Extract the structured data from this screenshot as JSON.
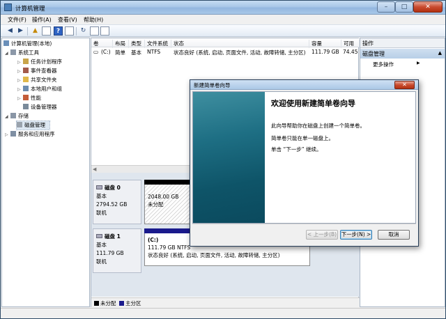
{
  "window": {
    "title": "计算机管理"
  },
  "menu": [
    "文件(F)",
    "操作(A)",
    "查看(V)",
    "帮助(H)"
  ],
  "tree": {
    "items": [
      {
        "label": "计算机管理(本地)",
        "icon": "computer-icon"
      },
      {
        "label": "系统工具",
        "icon": "tools-icon"
      },
      {
        "label": "任务计划程序",
        "icon": "clock-icon"
      },
      {
        "label": "事件查看器",
        "icon": "event-icon"
      },
      {
        "label": "共享文件夹",
        "icon": "folder-icon"
      },
      {
        "label": "本地用户和组",
        "icon": "users-icon"
      },
      {
        "label": "性能",
        "icon": "performance-icon"
      },
      {
        "label": "设备管理器",
        "icon": "device-icon"
      },
      {
        "label": "存储",
        "icon": "storage-icon"
      },
      {
        "label": "磁盘管理",
        "icon": "disk-icon"
      },
      {
        "label": "服务和应用程序",
        "icon": "services-icon"
      }
    ]
  },
  "volumes": {
    "headers": [
      "卷",
      "布局",
      "类型",
      "文件系统",
      "状态",
      "容量",
      "可用"
    ],
    "rows": [
      {
        "volume": "(C:)",
        "layout": "简单",
        "type": "基本",
        "fs": "NTFS",
        "status": "状态良好 (系统, 启动, 页面文件, 活动, 故障转储, 主分区)",
        "capacity": "111.79 GB",
        "free": "74.45"
      }
    ]
  },
  "disks": [
    {
      "name": "磁盘 0",
      "type": "基本",
      "size": "2794.52 GB",
      "state": "联机",
      "partition": {
        "size": "2048.00 GB",
        "status": "未分配"
      }
    },
    {
      "name": "磁盘 1",
      "type": "基本",
      "size": "111.79 GB",
      "state": "联机",
      "partition": {
        "label": "(C:)",
        "size": "111.79 GB NTFS",
        "status": "状态良好 (系统, 启动, 页面文件, 活动, 故障转储, 主分区)"
      }
    }
  ],
  "legend": [
    {
      "label": "未分配",
      "color": "#000000"
    },
    {
      "label": "主分区",
      "color": "#1a1a8c"
    }
  ],
  "actions": {
    "header": "操作",
    "section": "磁盘管理",
    "more": "更多操作"
  },
  "dialog": {
    "title": "新建简单卷向导",
    "heading": "欢迎使用新建简单卷向导",
    "p1": "此向导帮助你在磁盘上创建一个简单卷。",
    "p2": "简单卷只能在单一磁盘上。",
    "p3": "单击 “下一步” 继续。",
    "back": "< 上一步(B)",
    "next": "下一步(N) >",
    "cancel": "取消"
  },
  "colors": {
    "unallocated": "#000000",
    "primary": "#1a1a8c",
    "dialog_side": "#0e5468"
  }
}
